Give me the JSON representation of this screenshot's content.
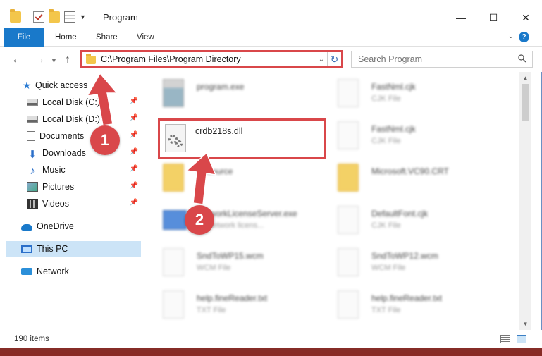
{
  "window": {
    "title": "Program",
    "controls": {
      "minimize": "—",
      "maximize": "☐",
      "close": "✕"
    }
  },
  "ribbon": {
    "tabs": [
      "File",
      "Home",
      "Share",
      "View"
    ],
    "help": "?"
  },
  "address": {
    "path": "C:\\Program Files\\Program Directory",
    "search_placeholder": "Search Program"
  },
  "sidebar": {
    "items": [
      {
        "label": "Quick access",
        "icon": "star-icon"
      },
      {
        "label": "Local Disk (C:)",
        "icon": "disk-icon",
        "pinned": true
      },
      {
        "label": "Local Disk (D:)",
        "icon": "disk-icon",
        "pinned": true
      },
      {
        "label": "Documents",
        "icon": "documents-icon",
        "pinned": true
      },
      {
        "label": "Downloads",
        "icon": "downloads-icon",
        "pinned": true
      },
      {
        "label": "Music",
        "icon": "music-icon",
        "pinned": true
      },
      {
        "label": "Pictures",
        "icon": "pictures-icon",
        "pinned": true
      },
      {
        "label": "Videos",
        "icon": "videos-icon",
        "pinned": true
      },
      {
        "label": "OneDrive",
        "icon": "onedrive-icon"
      },
      {
        "label": "This PC",
        "icon": "computer-icon",
        "selected": true
      },
      {
        "label": "Network",
        "icon": "network-icon"
      }
    ]
  },
  "files": {
    "left": [
      {
        "name": "program.exe",
        "type": ""
      },
      {
        "name": "crdb218s.dll",
        "type": ""
      },
      {
        "name": "Resource",
        "type": ""
      },
      {
        "name": "NetworkLicenseServer.exe",
        "type": "FF network licens..."
      },
      {
        "name": "SndToWP15.wcm",
        "type": "WCM File"
      },
      {
        "name": "help.fineReader.txt",
        "type": "TXT File"
      }
    ],
    "right": [
      {
        "name": "FastNml.cjk",
        "type": "CJK File"
      },
      {
        "name": "FastNml.cjk",
        "type": "CJK File"
      },
      {
        "name": "Microsoft.VC90.CRT",
        "type": ""
      },
      {
        "name": "DefaultFont.cjk",
        "type": "CJK File"
      },
      {
        "name": "SndToWP12.wcm",
        "type": "WCM File"
      },
      {
        "name": "help.fineReader.txt",
        "type": "TXT File"
      }
    ]
  },
  "status": {
    "item_count": "190 items"
  },
  "annotations": {
    "step1": "1",
    "step2": "2",
    "accent": "#d9474a"
  }
}
